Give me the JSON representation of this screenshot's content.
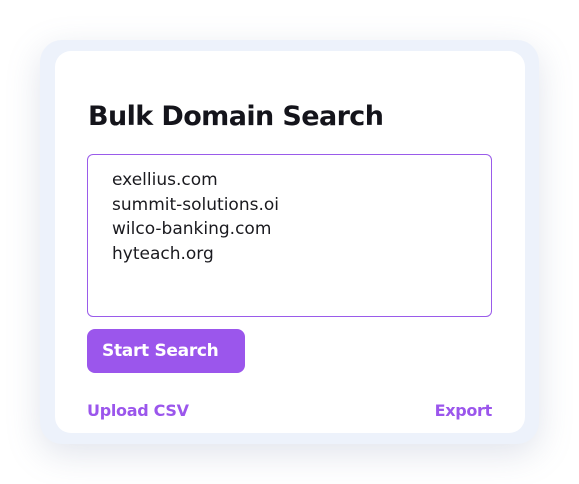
{
  "colors": {
    "accent": "#9b56ec",
    "title": "#14141b",
    "outer_panel": "#edf2fb",
    "card": "#ffffff"
  },
  "card": {
    "title": "Bulk Domain Search",
    "domains": [
      "exellius.com",
      "summit-solutions.oi",
      "wilco-banking.com",
      "hyteach.org"
    ],
    "start_button_label": "Start Search",
    "upload_link_label": "Upload CSV",
    "export_link_label": "Export"
  }
}
